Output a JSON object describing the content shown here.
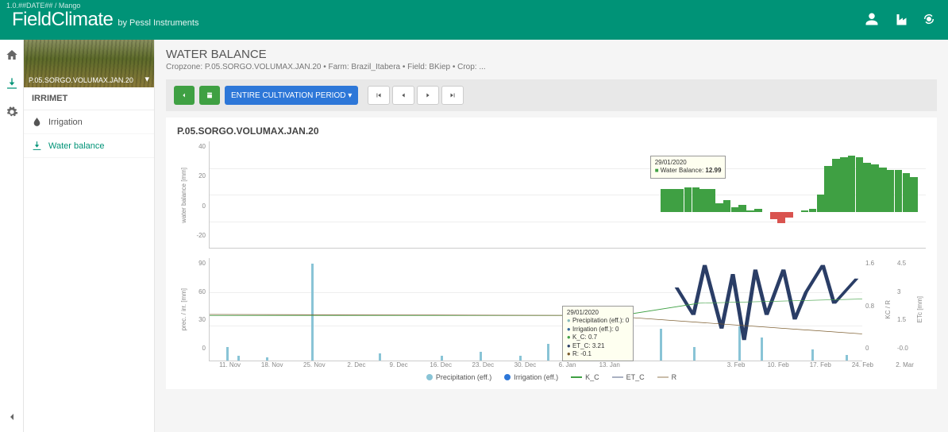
{
  "version": "1.0.##DATE## / Mango",
  "brand": {
    "main": "FieldClimate",
    "sub": "by Pessl Instruments"
  },
  "cropzone_selected": "P.05.SORGO.VOLUMAX.JAN.20",
  "sidebar": {
    "section": "IRRIMET",
    "items": [
      {
        "label": "Irrigation"
      },
      {
        "label": "Water balance"
      }
    ]
  },
  "header": {
    "title": "WATER BALANCE",
    "breadcrumb": "Cropzone: P.05.SORGO.VOLUMAX.JAN.20 • Farm: Brazil_Itabera • Field: BKiep • Crop: ..."
  },
  "toolbar": {
    "period_label": "ENTIRE CULTIVATION PERIOD"
  },
  "chart_title": "P.05.SORGO.VOLUMAX.JAN.20",
  "tooltip_top": {
    "date": "29/01/2020",
    "label": "Water Balance:",
    "value": "12.99"
  },
  "tooltip_bottom": {
    "date": "29/01/2020",
    "lines": [
      "Precipitation (eff.): 0",
      "Irrigation (eff.): 0",
      "K_C: 0.7",
      "ET_C: 3.21",
      "R: -0.1"
    ]
  },
  "legend": {
    "precip": "Precipitation (eff.)",
    "irrig": "Irrigation (eff.)",
    "kc": "K_C",
    "etc": "ET_C",
    "r": "R"
  },
  "axes": {
    "y_top_label": "water balance [mm]",
    "y_bot_label": "prec. / irr. [mm]",
    "y_right1_label": "KC / R",
    "y_right2_label": "ETc [mm]",
    "y_top_ticks": [
      "40",
      "20",
      "0",
      "-20"
    ],
    "y_bot_ticks": [
      "90",
      "60",
      "30",
      "0"
    ],
    "y_r1_ticks": [
      "1.6",
      "0.8",
      "0"
    ],
    "y_r2_ticks": [
      "4.5",
      "3",
      "1.5",
      "-0.0"
    ],
    "x_ticks": [
      "11. Nov",
      "18. Nov",
      "25. Nov",
      "2. Dec",
      "9. Dec",
      "16. Dec",
      "23. Dec",
      "30. Dec",
      "6. Jan",
      "13. Jan",
      "",
      "",
      "3. Feb",
      "10. Feb",
      "17. Feb",
      "24. Feb",
      "2. Mar"
    ]
  },
  "chart_data": [
    {
      "type": "bar",
      "title": "Water Balance",
      "ylabel": "water balance [mm]",
      "ylim": [
        -20,
        40
      ],
      "x_start": "2020-01-29",
      "x_end": "2020-03-02",
      "series": [
        {
          "name": "Water Balance",
          "color_pos": "#3fa043",
          "color_neg": "#d9534f",
          "values": [
            12.99,
            13,
            13,
            14,
            14,
            13,
            13,
            5,
            7,
            3,
            4,
            1,
            2,
            0,
            -4,
            -6,
            -3,
            0,
            1,
            2,
            10,
            26,
            30,
            31,
            32,
            31,
            28,
            27,
            25,
            24,
            24,
            22,
            20,
            0
          ]
        }
      ]
    },
    {
      "type": "line",
      "title": "Precip / Irrigation / KC / ETc / R",
      "xlabel": "",
      "x_range": [
        "2019-11-07",
        "2020-03-02"
      ],
      "left_axis": {
        "label": "prec. / irr. [mm]",
        "lim": [
          0,
          90
        ]
      },
      "right_axis1": {
        "label": "KC / R",
        "lim": [
          0,
          1.6
        ]
      },
      "right_axis2": {
        "label": "ETc [mm]",
        "lim": [
          0,
          4.5
        ]
      },
      "bars_precip": {
        "2019-11-10": 12,
        "2019-11-12": 4,
        "2019-11-17": 3,
        "2019-11-25": 85,
        "2019-12-07": 6,
        "2019-12-18": 4,
        "2019-12-25": 8,
        "2020-01-01": 4,
        "2020-01-06": 15,
        "2020-01-12": 5,
        "2020-01-18": 22,
        "2020-01-21": 10,
        "2020-01-26": 28,
        "2020-02-01": 12,
        "2020-02-09": 30,
        "2020-02-13": 20,
        "2020-02-22": 10,
        "2020-02-28": 5
      },
      "bars_irrig": {},
      "series": [
        {
          "name": "K_C",
          "axis": "right1",
          "color": "#3fa043",
          "values": {
            "start": 0.7,
            "end": 0.95,
            "shape": "ramp_after_2020-01-29"
          }
        },
        {
          "name": "ET_C",
          "axis": "right2",
          "color": "#2a3d66",
          "values": {
            "2020-01-29": 3.21,
            "2020-02-01": 2.0,
            "2020-02-03": 4.2,
            "2020-02-06": 1.4,
            "2020-02-08": 3.8,
            "2020-02-10": 0.9,
            "2020-02-12": 4.0,
            "2020-02-14": 2.0,
            "2020-02-17": 4.0,
            "2020-02-19": 1.8,
            "2020-02-21": 3.0,
            "2020-02-24": 4.2,
            "2020-02-26": 2.5,
            "2020-03-01": 3.6
          }
        },
        {
          "name": "R",
          "axis": "right1",
          "color": "#7a5a2a",
          "values": {
            "start": 0.7,
            "end": 0.35,
            "shape": "gentle_decline"
          }
        }
      ]
    }
  ]
}
